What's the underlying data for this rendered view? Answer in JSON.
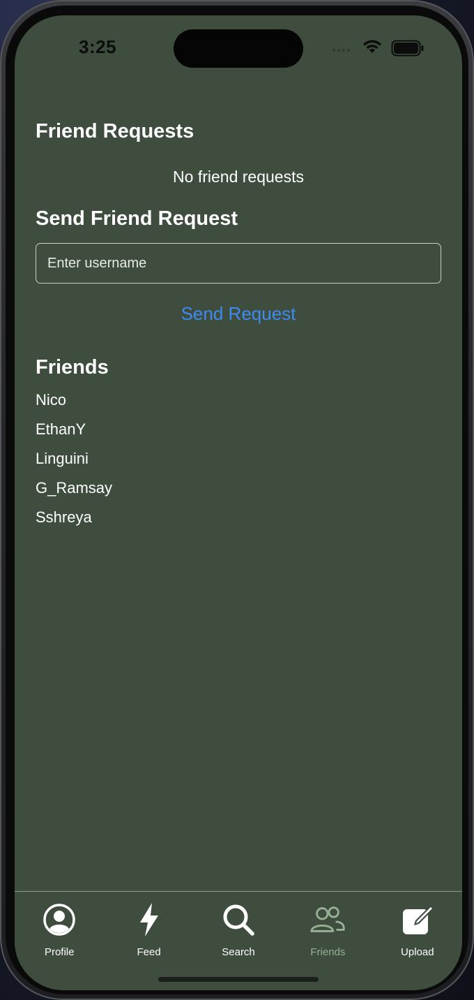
{
  "status_bar": {
    "time": "3:25"
  },
  "friend_requests": {
    "title": "Friend Requests",
    "empty_text": "No friend requests"
  },
  "send_request": {
    "title": "Send Friend Request",
    "input_placeholder": "Enter username",
    "input_value": "",
    "button_label": "Send Request"
  },
  "friends": {
    "title": "Friends",
    "items": [
      "Nico",
      "EthanY",
      "Linguini",
      "G_Ramsay",
      "Sshreya"
    ]
  },
  "tabbar": {
    "active": "Friends",
    "items": [
      {
        "label": "Profile",
        "icon": "profile-icon"
      },
      {
        "label": "Feed",
        "icon": "lightning-icon"
      },
      {
        "label": "Search",
        "icon": "search-icon"
      },
      {
        "label": "Friends",
        "icon": "friends-icon"
      },
      {
        "label": "Upload",
        "icon": "upload-icon"
      }
    ]
  },
  "colors": {
    "background": "#3f4d3e",
    "accent_link": "#3d8bf0",
    "active_tab": "#97b293"
  }
}
